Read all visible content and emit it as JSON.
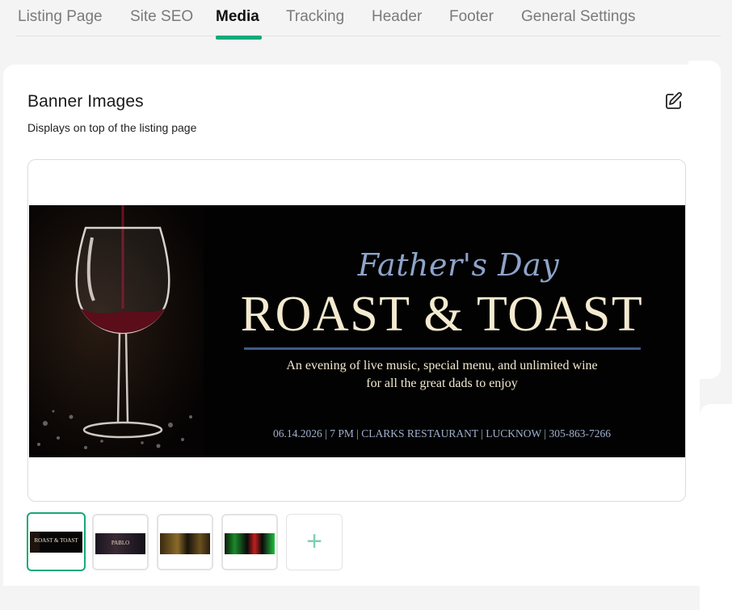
{
  "tabs": [
    {
      "label": "Listing Page",
      "active": false
    },
    {
      "label": "Site SEO",
      "active": false
    },
    {
      "label": "Media",
      "active": true
    },
    {
      "label": "Tracking",
      "active": false
    },
    {
      "label": "Header",
      "active": false
    },
    {
      "label": "Footer",
      "active": false
    },
    {
      "label": "General Settings",
      "active": false
    }
  ],
  "section": {
    "title": "Banner Images",
    "subtitle": "Displays on top of the listing page",
    "edit_icon": "edit-icon"
  },
  "banner": {
    "script_title": "Father's Day",
    "title": "ROAST & TOAST",
    "description_line1": "An evening of live music, special menu, and unlimited wine",
    "description_line2": "for all the great dads to enjoy",
    "footer": "06.14.2026 | 7 PM | CLARKS RESTAURANT | LUCKNOW | 305-863-7266"
  },
  "thumbnails": [
    {
      "name": "banner-roast-toast",
      "mini_text": "ROAST & TOAST",
      "selected": true
    },
    {
      "name": "banner-pablo",
      "mini_text": "PABLO",
      "selected": false
    },
    {
      "name": "banner-gold",
      "mini_text": "",
      "selected": false
    },
    {
      "name": "banner-green",
      "mini_text": "",
      "selected": false
    }
  ],
  "add_button": {
    "label": "+",
    "icon": "plus-icon"
  },
  "colors": {
    "accent": "#16a97a",
    "banner_bg": "#020202",
    "banner_title": "#f4ead0",
    "banner_script": "#8ea3c9"
  }
}
